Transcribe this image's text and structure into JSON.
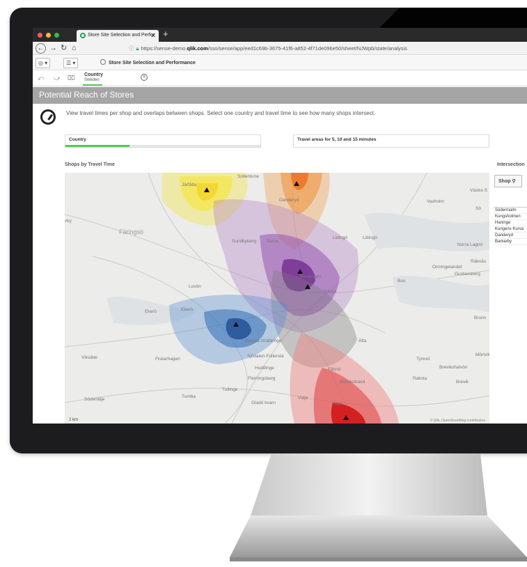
{
  "browser": {
    "tab_title": "Store Site Selection and Perfor",
    "new_tab": "+",
    "url_domain_prefix": "https://sense-demo.",
    "url_domain_bold": "qlik.com",
    "url_path": "/sso/sense/app/eed1c69b-3675-41f6-a852-4f71de096e50/sheet/NJWpb/state/analysis"
  },
  "toolbar": {
    "app_title": "Store Site Selection and Performance"
  },
  "selection": {
    "field": "Country",
    "value": "Sweden"
  },
  "sheet": {
    "title": "Potential Reach of Stores",
    "intro": "View travel times per shop and overlaps between shops. Select one country and travel time to see how many shops intersect."
  },
  "filters": {
    "country": {
      "title": "Country",
      "progress": 0.33
    },
    "travel": {
      "title": "Travel areas for 5, 10 and 15 minutes",
      "progress": 0
    }
  },
  "map": {
    "title": "Shops by Travel Time",
    "scale": "2 km",
    "attribution": "© Qlik, OpenStreetMap contributors",
    "places": [
      {
        "name": "Sollentuna",
        "big": false
      },
      {
        "name": "Järfälla",
        "big": false
      },
      {
        "name": "Danderyd",
        "big": false
      },
      {
        "name": "Västra S",
        "big": false
      },
      {
        "name": "Vaxholm",
        "big": false
      },
      {
        "name": "Sö",
        "big": false
      },
      {
        "name": "öderby",
        "big": false
      },
      {
        "name": "Färingsö",
        "big": true
      },
      {
        "name": "Sundbyberg",
        "big": false
      },
      {
        "name": "Solna",
        "big": false
      },
      {
        "name": "Lidingö",
        "big": false
      },
      {
        "name": "Lidingö",
        "big": false
      },
      {
        "name": "Norra Lagnö",
        "big": false
      },
      {
        "name": "Räknäs",
        "big": false
      },
      {
        "name": "Ormingelandet",
        "big": false
      },
      {
        "name": "Gustavsberg",
        "big": false
      },
      {
        "name": "Boo",
        "big": false
      },
      {
        "name": "Stockholm",
        "big": false
      },
      {
        "name": "Nacka",
        "big": false
      },
      {
        "name": "Lovön",
        "big": false
      },
      {
        "name": "Ekerö",
        "big": false
      },
      {
        "name": "Ekerö",
        "big": false
      },
      {
        "name": "Brunn",
        "big": false
      },
      {
        "name": "Stuvsta-Snättringe",
        "big": false
      },
      {
        "name": "Älta",
        "big": false
      },
      {
        "name": "Mörtviker",
        "big": false
      },
      {
        "name": "Viksäter",
        "big": false
      },
      {
        "name": "Fiskarhagen",
        "big": false
      },
      {
        "name": "Sjödalen-Fullersta",
        "big": false
      },
      {
        "name": "Huddinge",
        "big": false
      },
      {
        "name": "Fännö",
        "big": false
      },
      {
        "name": "Tyresö",
        "big": false
      },
      {
        "name": "Brevikshalvön",
        "big": false
      },
      {
        "name": "Flemingsberg",
        "big": false
      },
      {
        "name": "Raksta",
        "big": false
      },
      {
        "name": "Brevik",
        "big": false
      },
      {
        "name": "Brevikstrand",
        "big": false
      },
      {
        "name": "Tullinge",
        "big": false
      },
      {
        "name": "Tumba",
        "big": false
      },
      {
        "name": "Södertälje",
        "big": false
      },
      {
        "name": "Gladö kvarn",
        "big": false
      },
      {
        "name": "Vidja",
        "big": false
      },
      {
        "name": "Vega",
        "big": false
      }
    ]
  },
  "right_panel": {
    "title": "Intersection",
    "search_label": "Shop",
    "shops": [
      "Södermalm",
      "Kungsholmen",
      "Haninge",
      "Kungens Kurva",
      "Danderyd",
      "Barkarby"
    ]
  },
  "colors": {
    "selection_green": "#52cc52",
    "header_gray": "#a5a5a5",
    "yellow": "#f5e62a",
    "orange": "#f08a2a",
    "purple": "#8a3fa6",
    "blue": "#2f6db5",
    "red": "#e02020"
  }
}
